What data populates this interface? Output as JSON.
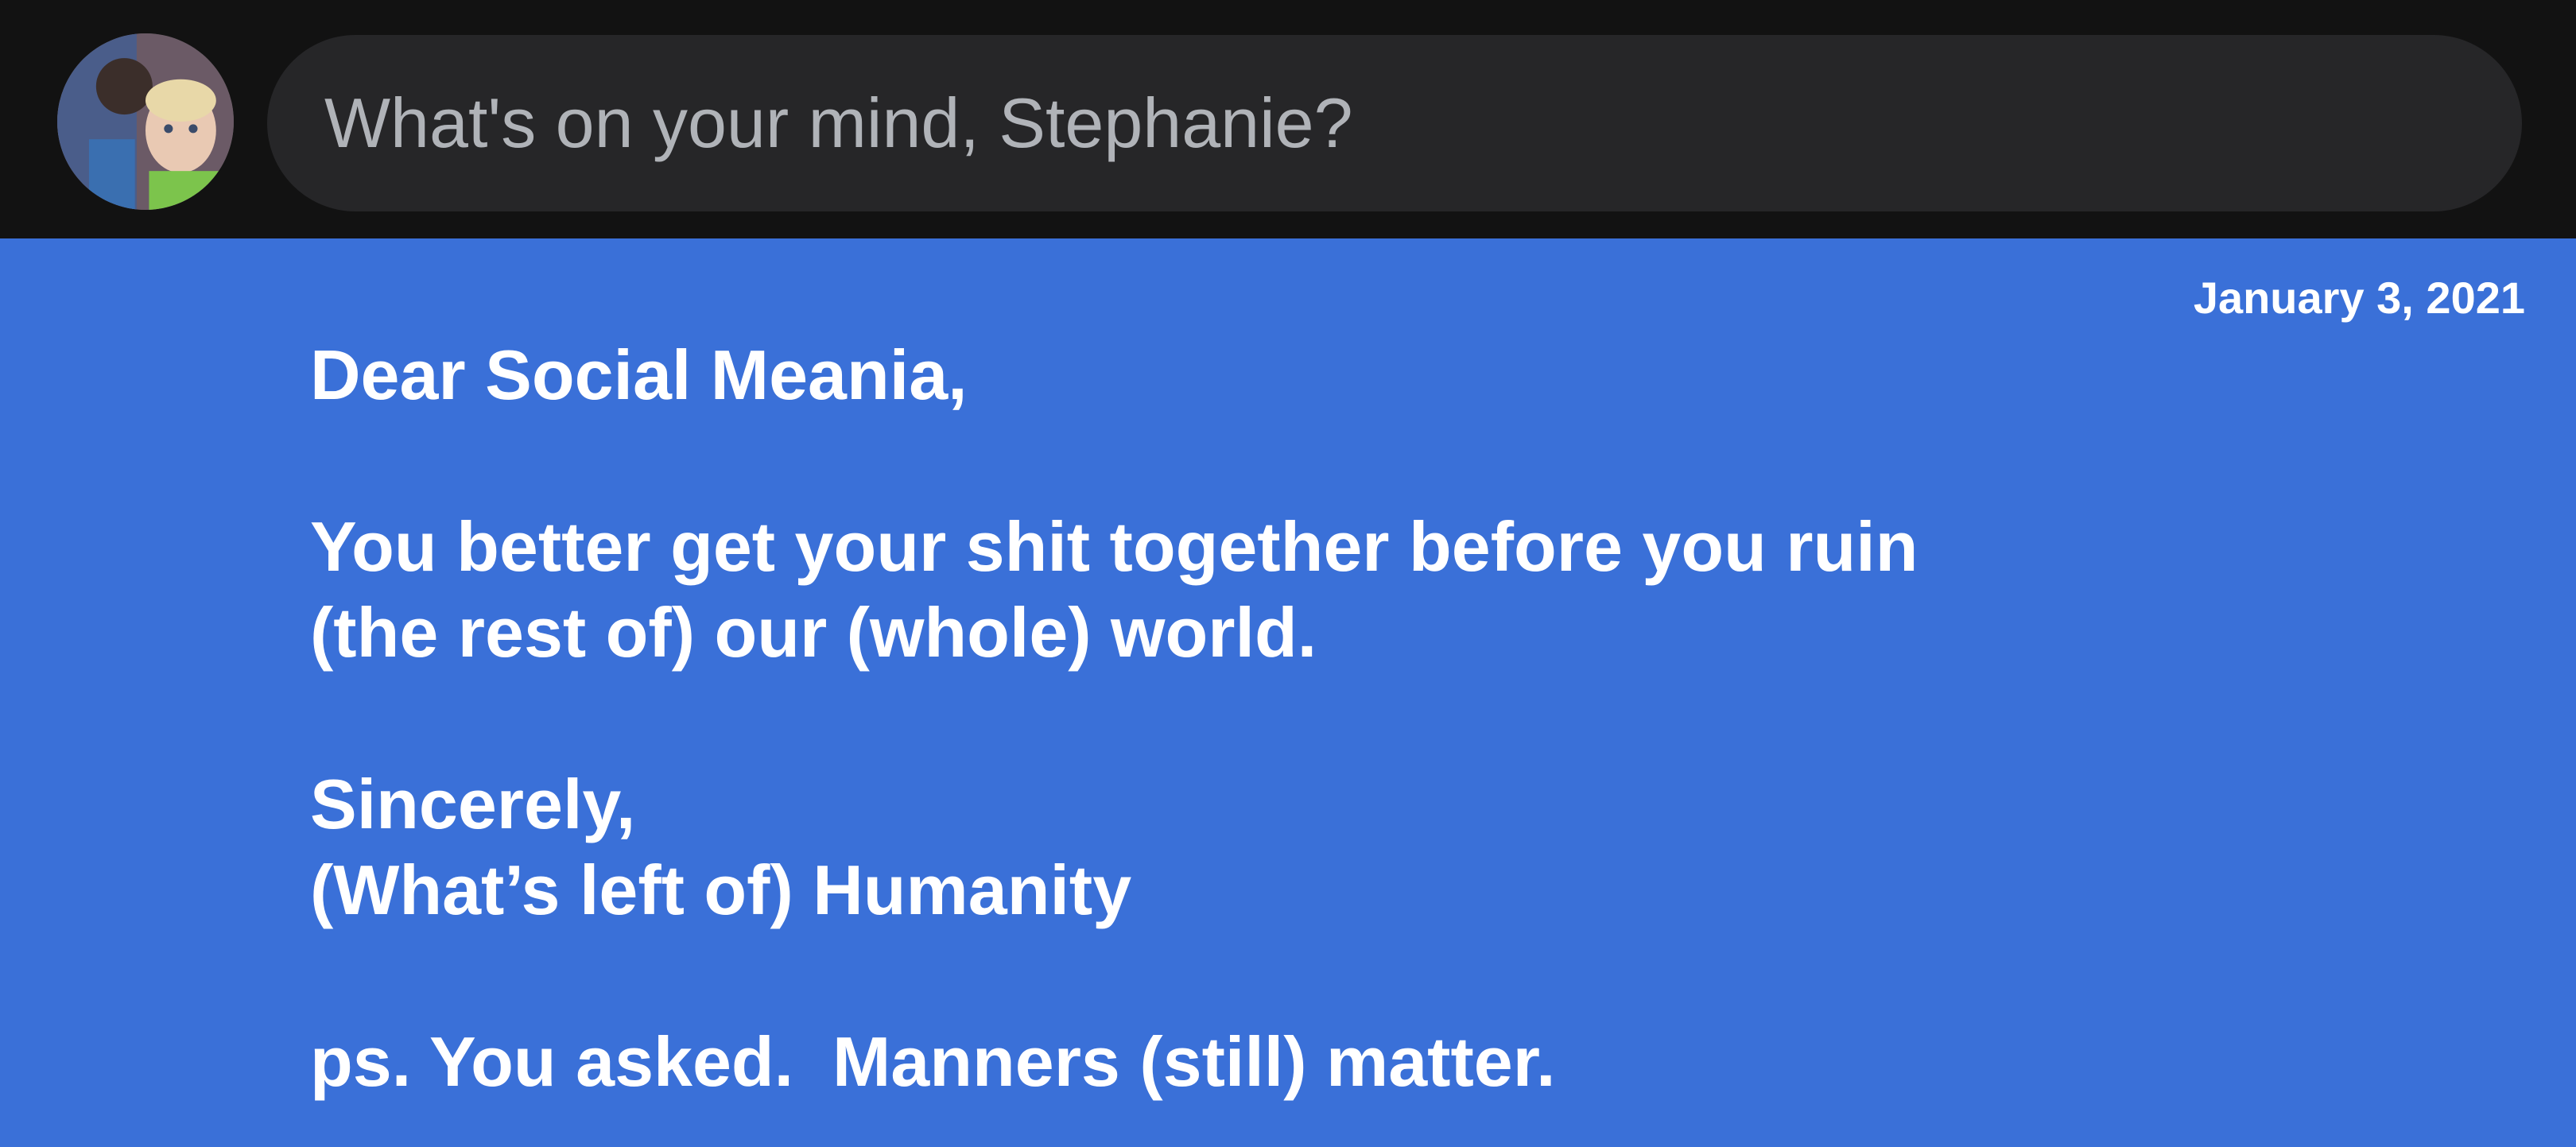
{
  "composer": {
    "placeholder": "What's on your mind, Stephanie?",
    "avatar_icon": "user-avatar-photo"
  },
  "post": {
    "date": "January 3, 2021",
    "background_color": "#3a70d8",
    "lines": {
      "greeting": "Dear Social Meania,",
      "body_line_1": "You better get your shit together before you ruin",
      "body_line_2": "(the rest of) our (whole) world.",
      "closing": "Sincerely,",
      "signature": "(What’s left of) Humanity",
      "postscript": "ps. You asked.  Manners (still) matter."
    }
  }
}
